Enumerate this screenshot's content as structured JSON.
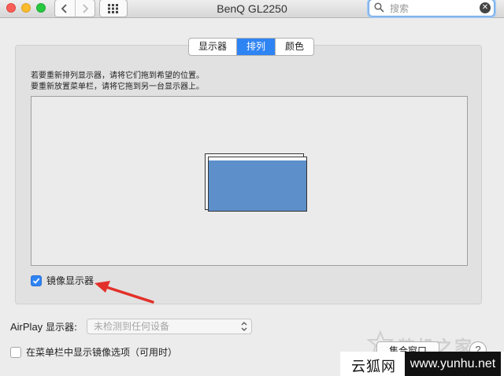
{
  "window": {
    "title": "BenQ GL2250",
    "search_placeholder": "搜索"
  },
  "tabs": [
    {
      "label": "显示器",
      "active": false
    },
    {
      "label": "排列",
      "active": true
    },
    {
      "label": "颜色",
      "active": false
    }
  ],
  "instructions": {
    "line1": "若要重新排列显示器，请将它们拖到希望的位置。",
    "line2": "要重新放置菜单栏，请将它拖到另一台显示器上。"
  },
  "mirror": {
    "label": "镜像显示器",
    "checked": true
  },
  "airplay": {
    "label_en": "AirPlay",
    "label_cn": " 显示器:",
    "selected": "未检测到任何设备"
  },
  "menubar_option": {
    "label": "在菜单栏中显示镜像选项（可用时）",
    "checked": false
  },
  "buttons": {
    "gather": "集合窗口",
    "help": "?"
  },
  "watermark": {
    "text": "装机之家",
    "left": "云狐网",
    "right": "www.yunhu.net"
  },
  "colors": {
    "accent": "#2f84f3",
    "display": "#5d8fca",
    "arrow": "#e3302a"
  },
  "icons": {
    "back": "chevron-left-icon",
    "forward": "chevron-right-icon",
    "show_all": "grid-icon",
    "search": "magnifier-icon",
    "clear": "clear-icon"
  }
}
